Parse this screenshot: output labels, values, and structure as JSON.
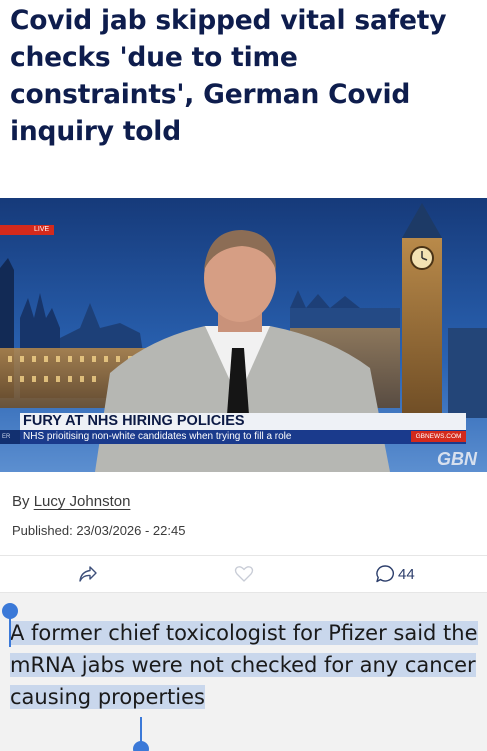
{
  "article": {
    "headline": "Covid jab skipped vital safety checks 'due to time constraints', German Covid inquiry told",
    "byline_prefix": "By",
    "author": "Lucy Johnston",
    "published": "Published: 23/03/2026 - 22:45"
  },
  "video": {
    "live_badge": "LIVE",
    "lower_third_title": "FURY AT NHS HIRING POLICIES",
    "lower_third_subtitle": "NHS prioitising non-white candidates when trying to fill a role",
    "left_tab": "ER",
    "site": "GBNEWS.COM",
    "logo": "GBN"
  },
  "actions": {
    "share_icon": "share-icon",
    "like_icon": "heart-icon",
    "comment_icon": "comment-icon",
    "comment_count": "44"
  },
  "selection": {
    "text": "A former chief toxicologist for Pfizer said the mRNA jabs were not checked for any cancer causing properties"
  },
  "colors": {
    "headline": "#0e1d4d",
    "selection_highlight": "#c9d7ec",
    "selection_handle": "#3b79d8",
    "live_red": "#d42a1c",
    "gb_news_blue": "#1a3a8c"
  }
}
